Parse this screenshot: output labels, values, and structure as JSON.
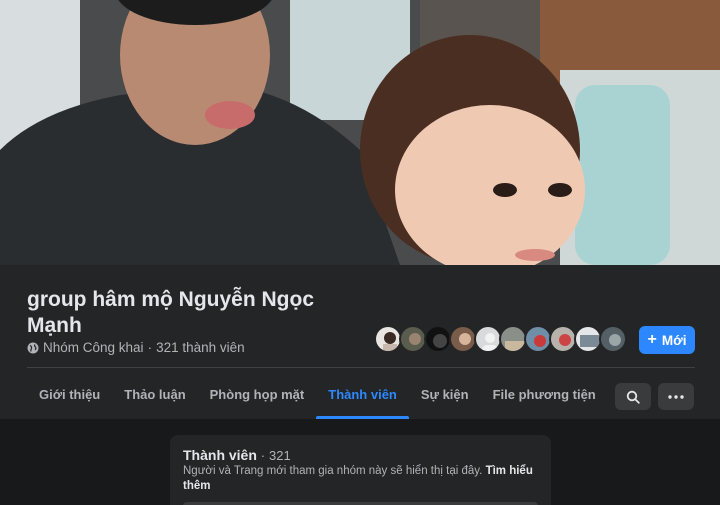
{
  "group": {
    "title": "group hâm mộ Nguyễn Ngọc Mạnh",
    "privacy": "Nhóm Công khai",
    "separator": "·",
    "members_text": "321 thành viên"
  },
  "actions": {
    "new_label": "Mới",
    "new_icon": "plus-icon",
    "search_icon": "search-icon",
    "more_icon": "more-icon"
  },
  "tabs": [
    {
      "label": "Giới thiệu",
      "active": false
    },
    {
      "label": "Thảo luận",
      "active": false
    },
    {
      "label": "Phòng họp mặt",
      "active": false
    },
    {
      "label": "Thành viên",
      "active": true
    },
    {
      "label": "Sự kiện",
      "active": false
    },
    {
      "label": "File phương tiện",
      "active": false
    }
  ],
  "members_card": {
    "title": "Thành viên",
    "separator": "·",
    "count": "321",
    "description": "Người và Trang mới tham gia nhóm này sẽ hiển thị tại đây.",
    "learn_more": "Tìm hiểu thêm"
  },
  "colors": {
    "accent": "#2d88ff",
    "background": "#18191a",
    "surface": "#242526",
    "secondary_text": "#b0b3b8"
  }
}
